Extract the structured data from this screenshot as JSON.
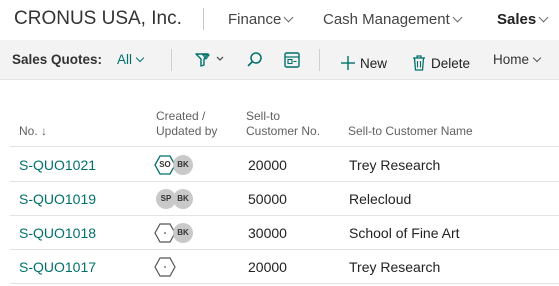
{
  "header": {
    "company": "CRONUS USA, Inc.",
    "nav": [
      "Finance",
      "Cash Management",
      "Sales"
    ]
  },
  "actionbar": {
    "page_caption": "Sales Quotes:",
    "view": "All",
    "new_label": "New",
    "delete_label": "Delete",
    "home_label": "Home"
  },
  "columns": {
    "no": "No.",
    "created_line1": "Created /",
    "created_line2": "Updated by",
    "sellto_line1": "Sell-to",
    "sellto_line2": "Customer No.",
    "name": "Sell-to Customer Name"
  },
  "rows": [
    {
      "no": "S-QUO1021",
      "created": "SO",
      "updated": "BK",
      "customer_no": "20000",
      "customer_name": "Trey Research"
    },
    {
      "no": "S-QUO1019",
      "created": "SP",
      "updated": "BK",
      "customer_no": "50000",
      "customer_name": "Relecloud"
    },
    {
      "no": "S-QUO1018",
      "created": "-",
      "updated": "BK",
      "customer_no": "30000",
      "customer_name": "School of Fine Art"
    },
    {
      "no": "S-QUO1017",
      "created": "-",
      "updated": "",
      "customer_no": "20000",
      "customer_name": "Trey Research"
    }
  ],
  "colors": {
    "accent": "#00706b",
    "badge_gray": "#c9c9c9"
  },
  "icons": {
    "filter": "filter-icon",
    "search": "search-icon",
    "edit_list": "edit-list-icon",
    "new": "plus-icon",
    "delete": "trash-icon",
    "sort": "sort-down-arrow-icon"
  }
}
